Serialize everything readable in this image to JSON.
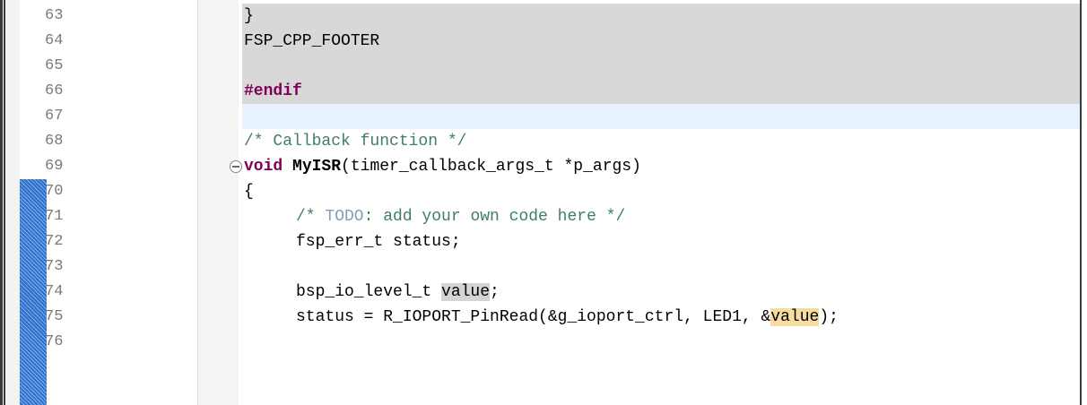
{
  "editor": {
    "lines": [
      {
        "num": "63",
        "text": "}"
      },
      {
        "num": "64",
        "text": "FSP_CPP_FOOTER"
      },
      {
        "num": "65",
        "text": ""
      },
      {
        "num": "66",
        "keyword": "#endif"
      },
      {
        "num": "67",
        "text": ""
      },
      {
        "num": "68",
        "comment": "/* Callback function */"
      },
      {
        "num": "69",
        "kw": "void",
        "fn": "MyISR",
        "rest": "(timer_callback_args_t *p_args)"
      },
      {
        "num": "70",
        "text": "{"
      },
      {
        "num": "71",
        "c_open": "/* ",
        "todo": "TODO",
        "c_rest": ": add your own code here */"
      },
      {
        "num": "72",
        "text": "fsp_err_t status;"
      },
      {
        "num": "73",
        "text": ""
      },
      {
        "num": "74",
        "pre": "bsp_io_level_t ",
        "hl": "value",
        "post": ";"
      },
      {
        "num": "75",
        "pre": "status = R_IOPORT_PinRead(&g_ioport_ctrl, LED1, &",
        "hl": "value",
        "post": ");"
      },
      {
        "num": "76",
        "text": ""
      }
    ]
  },
  "colors": {
    "keyword": "#7f0055",
    "comment": "#3f7f5f",
    "todo": "#7f9fbf",
    "inactive_code_bg": "#d8d8d8",
    "current_line_bg": "#e8f2fe",
    "read_occurrence": "#d4d4d4",
    "write_occurrence": "#f7dca0",
    "change_bar": "#3f7fd6"
  }
}
